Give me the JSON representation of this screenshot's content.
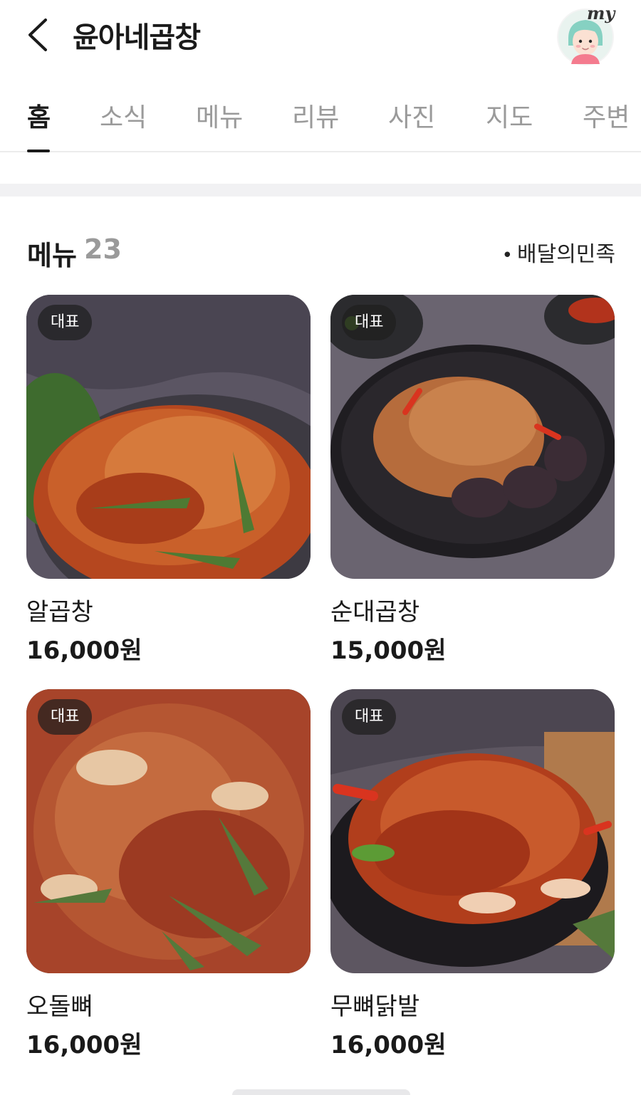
{
  "header": {
    "title": "윤아네곱창",
    "avatar_badge": "my"
  },
  "tabs": [
    {
      "label": "홈"
    },
    {
      "label": "소식"
    },
    {
      "label": "메뉴"
    },
    {
      "label": "리뷰"
    },
    {
      "label": "사진"
    },
    {
      "label": "지도"
    },
    {
      "label": "주변"
    }
  ],
  "menu_section": {
    "title": "메뉴",
    "count": "23",
    "source": "배달의민족"
  },
  "menu_items": [
    {
      "badge": "대표",
      "name": "알곱창",
      "price": "16,000원"
    },
    {
      "badge": "대표",
      "name": "순대곱창",
      "price": "15,000원"
    },
    {
      "badge": "대표",
      "name": "오돌뼈",
      "price": "16,000원"
    },
    {
      "badge": "대표",
      "name": "무뼈닭발",
      "price": "16,000원"
    }
  ],
  "colors": {
    "active_tab": "#1a1a1a",
    "inactive_tab": "#9a9a9a",
    "badge_bg": "#1e1e1eb8",
    "divider": "#f1f1f3"
  }
}
